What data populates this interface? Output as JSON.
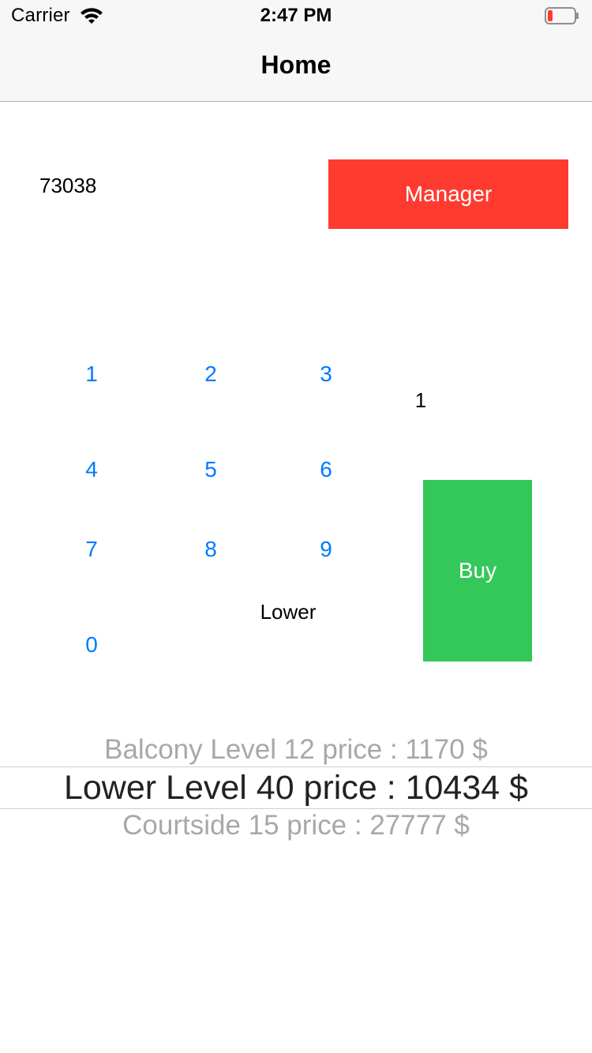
{
  "status_bar": {
    "carrier": "Carrier",
    "time": "2:47 PM",
    "battery_color": "#ff3b30",
    "wifi_icon": "wifi-icon",
    "battery_icon": "battery-icon"
  },
  "nav": {
    "title": "Home"
  },
  "main": {
    "code": "73038",
    "manager_label": "Manager",
    "manager_color": "#ff3b30",
    "keypad": [
      "1",
      "2",
      "3",
      "4",
      "5",
      "6",
      "7",
      "8",
      "9",
      "0"
    ],
    "keypad_color": "#007aff",
    "quantity": "1",
    "section": "Lower",
    "buy_label": "Buy",
    "buy_color": "#34c759"
  },
  "picker": {
    "rows": [
      "Balcony Level 12 price : 1170 $",
      "Lower Level 40 price : 10434 $",
      "Courtside 15 price : 27777 $"
    ],
    "selected_index": 1
  }
}
